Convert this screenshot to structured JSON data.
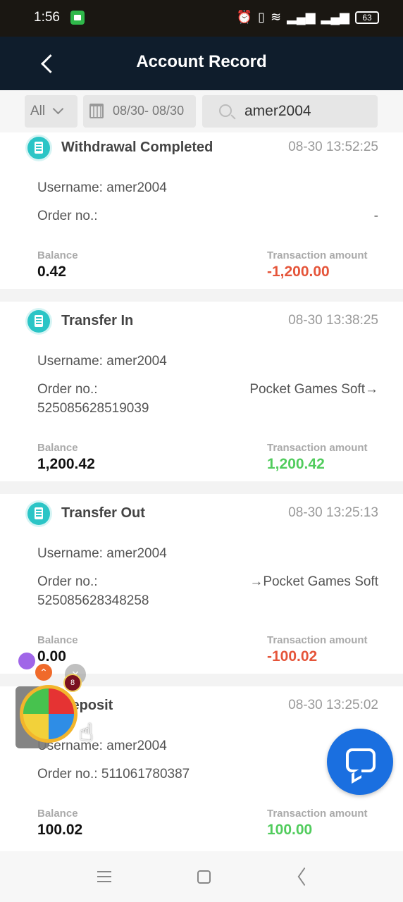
{
  "status_bar": {
    "time": "1:56",
    "battery": "63"
  },
  "header": {
    "title": "Account Record"
  },
  "filters": {
    "type_label": "All",
    "date_range": "08/30- 08/30",
    "search_value": "amer2004"
  },
  "records": [
    {
      "type": "Withdrawal Completed",
      "time": "08-30 13:52:25",
      "username_text": "Username: amer2004",
      "order_label": "Order no.:",
      "order_number": "",
      "order_extra": "-",
      "balance_label": "Balance",
      "balance": "0.42",
      "amount_label": "Transaction amount",
      "amount": "-1,200.00"
    },
    {
      "type": "Transfer In",
      "time": "08-30 13:38:25",
      "username_text": "Username: amer2004",
      "order_label": "Order no.:",
      "order_number": "525085628519039",
      "order_extra": "Pocket Games Soft→",
      "balance_label": "Balance",
      "balance": "1,200.42",
      "amount_label": "Transaction amount",
      "amount": "1,200.42"
    },
    {
      "type": "Transfer Out",
      "time": "08-30 13:25:13",
      "username_text": "Username: amer2004",
      "order_label": "Order no.:",
      "order_number": "525085628348258",
      "order_extra": "→Pocket Games Soft",
      "balance_label": "Balance",
      "balance": "0.00",
      "amount_label": "Transaction amount",
      "amount": "-100.02"
    },
    {
      "type": "Deposit",
      "time": "08-30 13:25:02",
      "username_text": "Username: amer2004",
      "order_text": "Order no.: 511061780387",
      "balance_label": "Balance",
      "balance": "100.02",
      "amount_label": "Transaction amount",
      "amount": "100.00"
    }
  ],
  "widget": {
    "badge": "8"
  },
  "colors": {
    "header_bg": "#0f1d2c",
    "negative": "#e5553a",
    "positive": "#51cc5d",
    "chat_button": "#1a6fe0",
    "record_icon": "#2bc5c6"
  }
}
